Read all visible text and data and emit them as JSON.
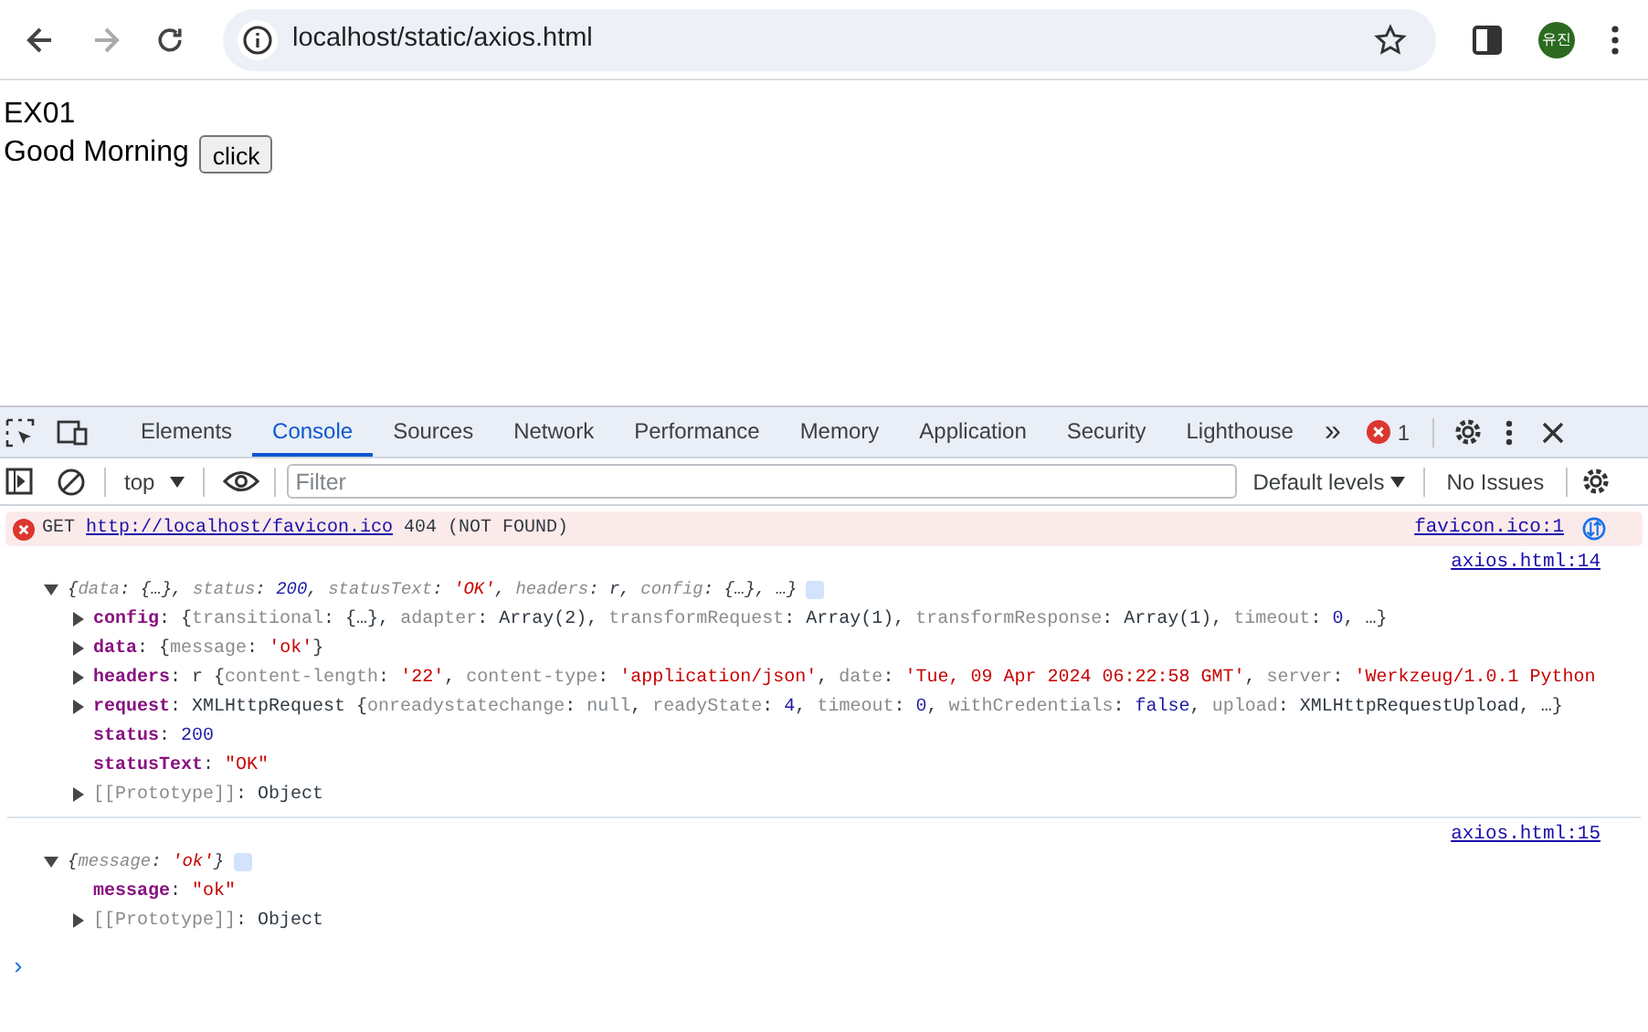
{
  "browser": {
    "url": "localhost/static/axios.html",
    "avatar": "유진"
  },
  "page": {
    "heading": "EX01",
    "greeting": "Good Morning",
    "button": "click"
  },
  "devtools": {
    "tabs": [
      {
        "label": "Elements",
        "selected": false
      },
      {
        "label": "Console",
        "selected": true
      },
      {
        "label": "Sources",
        "selected": false
      },
      {
        "label": "Network",
        "selected": false
      },
      {
        "label": "Performance",
        "selected": false
      },
      {
        "label": "Memory",
        "selected": false
      },
      {
        "label": "Application",
        "selected": false
      },
      {
        "label": "Security",
        "selected": false
      },
      {
        "label": "Lighthouse",
        "selected": false
      }
    ],
    "more_tabs": "»",
    "error_count": "1",
    "toolbar": {
      "context": "top",
      "filter_placeholder": "Filter",
      "levels": "Default levels",
      "issues": "No Issues"
    },
    "messages": [
      {
        "kind": "error",
        "method": "GET",
        "url": "http://localhost/favicon.ico",
        "text": "404 (NOT FOUND)",
        "source": "favicon.ico:1"
      },
      {
        "kind": "log",
        "source": "axios.html:14",
        "expanded": true,
        "summary": [
          {
            "kind": "punct",
            "text": "{"
          },
          {
            "kind": "prop",
            "text": "data"
          },
          {
            "kind": "punct",
            "text": ": {…}, "
          },
          {
            "kind": "prop",
            "text": "status"
          },
          {
            "kind": "punct",
            "text": ": "
          },
          {
            "kind": "num",
            "text": "200"
          },
          {
            "kind": "punct",
            "text": ", "
          },
          {
            "kind": "prop",
            "text": "statusText"
          },
          {
            "kind": "punct",
            "text": ": "
          },
          {
            "kind": "str",
            "text": "'OK'"
          },
          {
            "kind": "punct",
            "text": ", "
          },
          {
            "kind": "prop",
            "text": "headers"
          },
          {
            "kind": "punct",
            "text": ": r, "
          },
          {
            "kind": "prop",
            "text": "config"
          },
          {
            "kind": "punct",
            "text": ": {…}, …}"
          }
        ],
        "rows": [
          {
            "key": "config",
            "internal": false,
            "kind": "object",
            "expanded": false,
            "value": [
              {
                "kind": "punct",
                "text": ": {"
              },
              {
                "kind": "prop",
                "text": "transitional"
              },
              {
                "kind": "punct",
                "text": ": {…}, "
              },
              {
                "kind": "prop",
                "text": "adapter"
              },
              {
                "kind": "punct",
                "text": ": Array(2), "
              },
              {
                "kind": "prop",
                "text": "transformRequest"
              },
              {
                "kind": "punct",
                "text": ": Array(1), "
              },
              {
                "kind": "prop",
                "text": "transformResponse"
              },
              {
                "kind": "punct",
                "text": ": Array(1), "
              },
              {
                "kind": "prop",
                "text": "timeout"
              },
              {
                "kind": "punct",
                "text": ": "
              },
              {
                "kind": "num",
                "text": "0"
              },
              {
                "kind": "punct",
                "text": ", …}"
              }
            ]
          },
          {
            "key": "data",
            "internal": false,
            "kind": "object",
            "expanded": false,
            "value": [
              {
                "kind": "punct",
                "text": ": {"
              },
              {
                "kind": "prop",
                "text": "message"
              },
              {
                "kind": "punct",
                "text": ": "
              },
              {
                "kind": "str",
                "text": "'ok'"
              },
              {
                "kind": "punct",
                "text": "}"
              }
            ]
          },
          {
            "key": "headers",
            "internal": false,
            "kind": "object",
            "expanded": false,
            "value": [
              {
                "kind": "punct",
                "text": ": r {"
              },
              {
                "kind": "prop",
                "text": "content-length"
              },
              {
                "kind": "punct",
                "text": ": "
              },
              {
                "kind": "str",
                "text": "'22'"
              },
              {
                "kind": "punct",
                "text": ", "
              },
              {
                "kind": "prop",
                "text": "content-type"
              },
              {
                "kind": "punct",
                "text": ": "
              },
              {
                "kind": "str",
                "text": "'application/json'"
              },
              {
                "kind": "punct",
                "text": ", "
              },
              {
                "kind": "prop",
                "text": "date"
              },
              {
                "kind": "punct",
                "text": ": "
              },
              {
                "kind": "str",
                "text": "'Tue, 09 Apr 2024 06:22:58 GMT'"
              },
              {
                "kind": "punct",
                "text": ", "
              },
              {
                "kind": "prop",
                "text": "server"
              },
              {
                "kind": "punct",
                "text": ": "
              },
              {
                "kind": "str",
                "text": "'Werkzeug/1.0.1 Python"
              }
            ]
          },
          {
            "key": "request",
            "internal": false,
            "kind": "object",
            "expanded": false,
            "value": [
              {
                "kind": "punct",
                "text": ": XMLHttpRequest {"
              },
              {
                "kind": "prop",
                "text": "onreadystatechange"
              },
              {
                "kind": "punct",
                "text": ": "
              },
              {
                "kind": "null",
                "text": "null"
              },
              {
                "kind": "punct",
                "text": ", "
              },
              {
                "kind": "prop",
                "text": "readyState"
              },
              {
                "kind": "punct",
                "text": ": "
              },
              {
                "kind": "num",
                "text": "4"
              },
              {
                "kind": "punct",
                "text": ", "
              },
              {
                "kind": "prop",
                "text": "timeout"
              },
              {
                "kind": "punct",
                "text": ": "
              },
              {
                "kind": "num",
                "text": "0"
              },
              {
                "kind": "punct",
                "text": ", "
              },
              {
                "kind": "prop",
                "text": "withCredentials"
              },
              {
                "kind": "punct",
                "text": ": "
              },
              {
                "kind": "num",
                "text": "false"
              },
              {
                "kind": "punct",
                "text": ", "
              },
              {
                "kind": "prop",
                "text": "upload"
              },
              {
                "kind": "punct",
                "text": ": XMLHttpRequestUpload, …}"
              }
            ]
          },
          {
            "key": "status",
            "internal": false,
            "kind": "primitive",
            "value": [
              {
                "kind": "punct",
                "text": ": "
              },
              {
                "kind": "num",
                "text": "200"
              }
            ]
          },
          {
            "key": "statusText",
            "internal": false,
            "kind": "primitive",
            "value": [
              {
                "kind": "punct",
                "text": ": "
              },
              {
                "kind": "str",
                "text": "\"OK\""
              }
            ]
          },
          {
            "key": "[[Prototype]]",
            "internal": true,
            "kind": "object",
            "expanded": false,
            "value": [
              {
                "kind": "punct",
                "text": ": Object"
              }
            ]
          }
        ]
      },
      {
        "kind": "log",
        "source": "axios.html:15",
        "expanded": true,
        "summary": [
          {
            "kind": "punct",
            "text": "{"
          },
          {
            "kind": "prop",
            "text": "message"
          },
          {
            "kind": "punct",
            "text": ": "
          },
          {
            "kind": "str",
            "text": "'ok'"
          },
          {
            "kind": "punct",
            "text": "}"
          }
        ],
        "rows": [
          {
            "key": "message",
            "internal": false,
            "kind": "primitive",
            "value": [
              {
                "kind": "punct",
                "text": ": "
              },
              {
                "kind": "str",
                "text": "\"ok\""
              }
            ]
          },
          {
            "key": "[[Prototype]]",
            "internal": true,
            "kind": "object",
            "expanded": false,
            "value": [
              {
                "kind": "punct",
                "text": ": Object"
              }
            ]
          }
        ]
      }
    ],
    "prompt": "›"
  }
}
